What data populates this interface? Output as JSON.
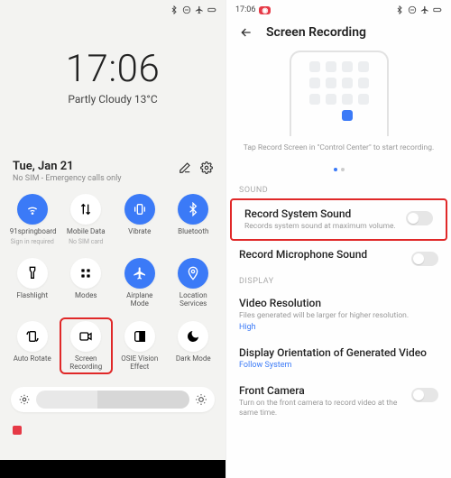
{
  "left": {
    "status": {
      "time": ""
    },
    "clock": "17:06",
    "weather": "Partly Cloudy 13°C",
    "date": "Tue, Jan 21",
    "sim": "No SIM - Emergency calls only",
    "tiles": [
      {
        "label": "91springboard",
        "sub": "Sign in required",
        "on": true
      },
      {
        "label": "Mobile Data",
        "sub": "No SIM card",
        "on": false
      },
      {
        "label": "Vibrate",
        "sub": "",
        "on": true
      },
      {
        "label": "Bluetooth",
        "sub": "",
        "on": true
      },
      {
        "label": "Flashlight",
        "sub": "",
        "on": false
      },
      {
        "label": "Modes",
        "sub": "",
        "on": false
      },
      {
        "label": "Airplane Mode",
        "sub": "",
        "on": true
      },
      {
        "label": "Location\nServices",
        "sub": "",
        "on": true
      },
      {
        "label": "Auto Rotate",
        "sub": "",
        "on": false
      },
      {
        "label": "Screen\nRecording",
        "sub": "",
        "on": false
      },
      {
        "label": "OSIE Vision\nEffect",
        "sub": "",
        "on": false
      },
      {
        "label": "Dark Mode",
        "sub": "",
        "on": false
      }
    ]
  },
  "right": {
    "status_time": "17:06",
    "title": "Screen Recording",
    "caption": "Tap Record Screen in \"Control Center\" to start recording.",
    "section_sound": "SOUND",
    "record_system": {
      "title": "Record System Sound",
      "sub": "Records system sound at maximum volume."
    },
    "record_mic": {
      "title": "Record Microphone Sound"
    },
    "section_display": "DISPLAY",
    "video_res": {
      "title": "Video Resolution",
      "sub": "Files generated will be larger for higher resolution.",
      "link": "High"
    },
    "orientation": {
      "title": "Display Orientation of Generated Video",
      "link": "Follow System"
    },
    "front_cam": {
      "title": "Front Camera",
      "sub": "Turn on the front camera to record video at the same time."
    }
  }
}
